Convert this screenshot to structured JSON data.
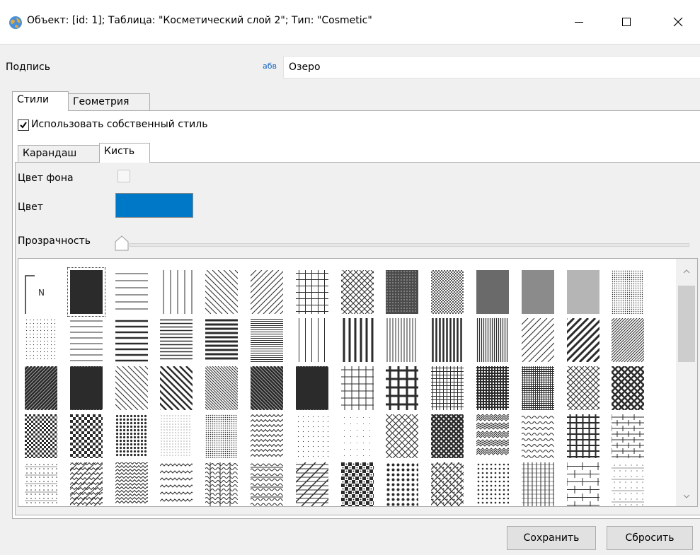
{
  "window": {
    "title": "Объект: [id: 1]; Таблица: \"Косметический слой 2\"; Тип: \"Cosmetic\"",
    "app_icon": "globe-icon",
    "controls": [
      "minimize-icon",
      "maximize-icon",
      "close-icon"
    ]
  },
  "caption": {
    "label": "Подпись",
    "badge": "абв",
    "value": "Озеро"
  },
  "tabs": [
    {
      "label": "Стили",
      "active": true
    },
    {
      "label": "Геометрия",
      "active": false
    }
  ],
  "own_style": {
    "label": "Использовать собственный стиль",
    "checked": true
  },
  "inner_tabs": [
    {
      "label": "Карандаш",
      "active": false
    },
    {
      "label": "Кисть",
      "active": true
    }
  ],
  "brush": {
    "bgcolor_label": "Цвет фона",
    "bgcolor_checked": false,
    "color_label": "Цвет",
    "color_value": "#0078c8",
    "opacity_label": "Прозрачность",
    "opacity_value": 0
  },
  "patterns": {
    "selected_index": 1,
    "first_cell_label": "N",
    "rows": 5,
    "columns": 14
  },
  "buttons": {
    "save": "Сохранить",
    "reset": "Сбросить"
  }
}
